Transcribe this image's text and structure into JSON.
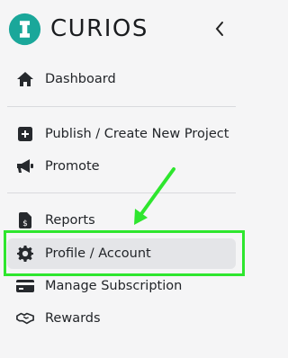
{
  "brand": {
    "name": "CURIOS",
    "logo_icon": "curios-logo-icon",
    "accent": "#1aa79a"
  },
  "header": {
    "collapse_icon": "chevron-left-icon"
  },
  "nav": {
    "items": [
      {
        "label": "Dashboard",
        "icon": "home-icon"
      },
      {
        "label": "Publish / Create New Project",
        "icon": "plus-square-icon"
      },
      {
        "label": "Promote",
        "icon": "megaphone-icon"
      },
      {
        "label": "Reports",
        "icon": "invoice-icon"
      },
      {
        "label": "Profile / Account",
        "icon": "gear-icon",
        "active": true
      },
      {
        "label": "Manage Subscription",
        "icon": "credit-card-icon"
      },
      {
        "label": "Rewards",
        "icon": "handshake-icon"
      }
    ]
  },
  "annotation": {
    "highlight_color": "#2ee62e"
  }
}
